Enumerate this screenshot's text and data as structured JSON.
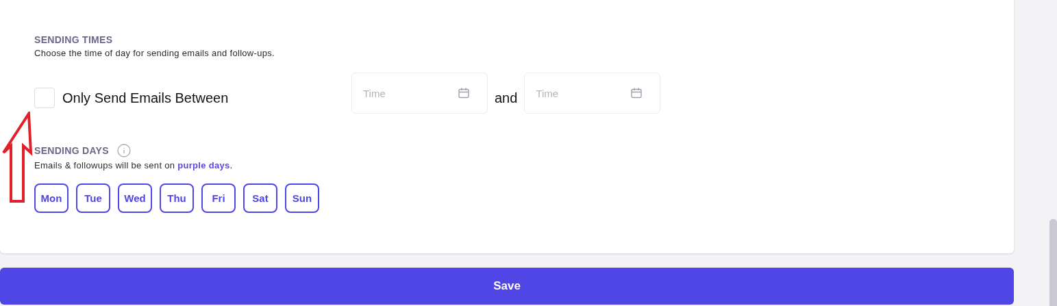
{
  "sending_times": {
    "heading": "SENDING TIMES",
    "description": "Choose the time of day for sending emails and follow-ups.",
    "only_between": {
      "label": "Only Send Emails Between",
      "checked": false
    },
    "start_time": {
      "placeholder": "Time"
    },
    "joiner": "and",
    "end_time": {
      "placeholder": "Time"
    }
  },
  "sending_days": {
    "heading": "SENDING DAYS",
    "description": "Emails & followups will be sent on **purple days**.",
    "days": [
      {
        "label": "Mon",
        "selected": true
      },
      {
        "label": "Tue",
        "selected": true
      },
      {
        "label": "Wed",
        "selected": true
      },
      {
        "label": "Thu",
        "selected": true
      },
      {
        "label": "Fri",
        "selected": true
      },
      {
        "label": "Sat",
        "selected": true
      },
      {
        "label": "Sun",
        "selected": true
      }
    ]
  },
  "annotations": [
    {
      "kind": "arrow"
    }
  ],
  "save_button": "Save"
}
